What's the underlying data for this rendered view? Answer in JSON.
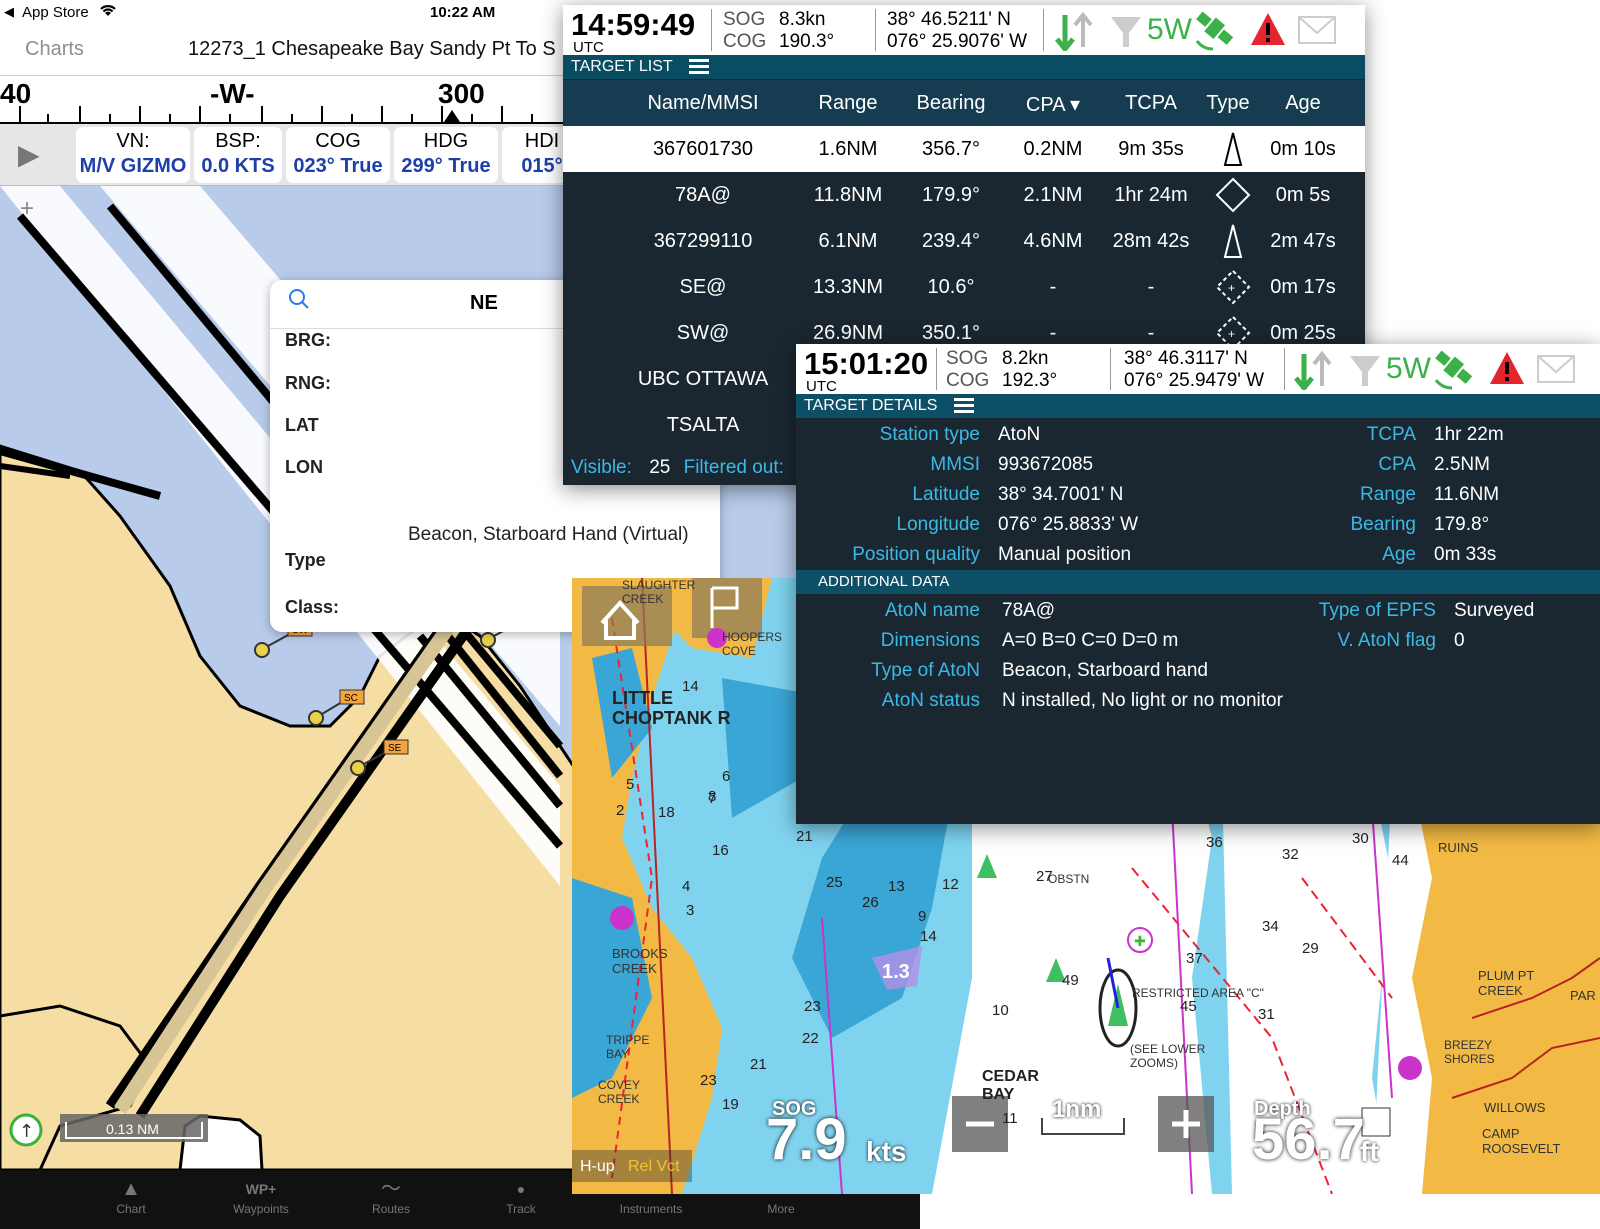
{
  "ipad": {
    "status": {
      "carrier": "App Store",
      "time": "10:22 AM"
    },
    "nav": {
      "back": "Charts",
      "title": "12273_1 Chesapeake Bay Sandy Pt To S"
    },
    "compass": {
      "ticks": [
        "40",
        "-W-",
        "300"
      ]
    },
    "instruments": [
      {
        "key": "VN:",
        "value": "M/V GIZMO"
      },
      {
        "key": "BSP:",
        "value": "0.0 KTS"
      },
      {
        "key": "COG",
        "value": "023° True"
      },
      {
        "key": "HDG",
        "value": "299° True"
      },
      {
        "key": "HDI",
        "value": "015°"
      }
    ],
    "popup": {
      "title": "NE",
      "labels": [
        "BRG:",
        "RNG:",
        "LAT",
        "LON",
        "Type",
        "Class:"
      ],
      "type_value": "Beacon, Starboard Hand (Virtual)"
    },
    "markers": [
      "SW",
      "SC",
      "SE",
      "NE"
    ],
    "scale": "0.13 NM",
    "tabs": [
      "Chart",
      "Waypoints",
      "Routes",
      "Track",
      "Instruments",
      "More"
    ],
    "tab_icons": [
      "▲",
      "WP+",
      "〜",
      "●",
      "",
      ""
    ]
  },
  "target_list": {
    "time": "14:59:49",
    "utc": "UTC",
    "sog_label": "SOG",
    "sog": "8.3kn",
    "cog_label": "COG",
    "cog": "190.3°",
    "lat": "38° 46.5211' N",
    "lon": "076° 25.9076' W",
    "gps_label": "5W",
    "bar_title": "TARGET LIST",
    "headers": [
      "Name/MMSI",
      "Range",
      "Bearing",
      "CPA ▾",
      "TCPA",
      "Type",
      "Age"
    ],
    "rows": [
      {
        "name": "367601730",
        "range": "1.6NM",
        "bearing": "356.7°",
        "cpa": "0.2NM",
        "tcpa": "9m 35s",
        "type": "vessel",
        "age": "0m 10s",
        "selected": true
      },
      {
        "name": "78A@",
        "range": "11.8NM",
        "bearing": "179.9°",
        "cpa": "2.1NM",
        "tcpa": "1hr 24m",
        "type": "diamond",
        "age": "0m 5s"
      },
      {
        "name": "367299110",
        "range": "6.1NM",
        "bearing": "239.4°",
        "cpa": "4.6NM",
        "tcpa": "28m 42s",
        "type": "vessel",
        "age": "2m 47s"
      },
      {
        "name": "SE@",
        "range": "13.3NM",
        "bearing": "10.6°",
        "cpa": "-",
        "tcpa": "-",
        "type": "virtual",
        "age": "0m 17s"
      },
      {
        "name": "SW@",
        "range": "26.9NM",
        "bearing": "350.1°",
        "cpa": "-",
        "tcpa": "-",
        "type": "virtual",
        "age": "0m 25s"
      },
      {
        "name": "UBC OTTAWA",
        "range": "",
        "bearing": "",
        "cpa": "",
        "tcpa": "",
        "type": "",
        "age": ""
      },
      {
        "name": "TSALTA",
        "range": "",
        "bearing": "",
        "cpa": "",
        "tcpa": "",
        "type": "",
        "age": ""
      }
    ],
    "footer": {
      "visible_label": "Visible:",
      "visible": "25",
      "filtered_label": "Filtered out:"
    }
  },
  "target_details": {
    "time": "15:01:20",
    "utc": "UTC",
    "sog_label": "SOG",
    "sog": "8.2kn",
    "cog_label": "COG",
    "cog": "192.3°",
    "lat": "38° 46.3117' N",
    "lon": "076° 25.9479' W",
    "gps_label": "5W",
    "bar_title": "TARGET DETAILS",
    "left": [
      {
        "label": "Station type",
        "value": "AtoN"
      },
      {
        "label": "MMSI",
        "value": "993672085"
      },
      {
        "label": "Latitude",
        "value": "38° 34.7001' N"
      },
      {
        "label": "Longitude",
        "value": "076° 25.8833' W"
      },
      {
        "label": "Position quality",
        "value": "Manual position"
      }
    ],
    "right": [
      {
        "label": "TCPA",
        "value": "1hr 22m"
      },
      {
        "label": "CPA",
        "value": "2.5NM"
      },
      {
        "label": "Range",
        "value": "11.6NM"
      },
      {
        "label": "Bearing",
        "value": "179.8°"
      },
      {
        "label": "Age",
        "value": "0m 33s"
      }
    ],
    "additional_title": "ADDITIONAL DATA",
    "additional_left": [
      {
        "label": "AtoN name",
        "value": "78A@"
      },
      {
        "label": "Dimensions",
        "value": "A=0 B=0 C=0 D=0 m"
      },
      {
        "label": "Type of AtoN",
        "value": "Beacon, Starboard hand"
      },
      {
        "label": "AtoN status",
        "value": "N installed, No light or no monitor"
      }
    ],
    "additional_right": [
      {
        "label": "Type of EPFS",
        "value": "Surveyed"
      },
      {
        "label": "V. AtoN flag",
        "value": "0"
      }
    ]
  },
  "navmap": {
    "sog_label": "SOG",
    "sog": "7.9",
    "sog_unit": "kts",
    "depth_label": "Depth",
    "depth": "56.7",
    "depth_unit": "ft",
    "scale": "1nm",
    "orientation": "H-up",
    "vector": "Rel Vct",
    "labels": [
      "LITTLE CHOPTANK R",
      "BROOKS CREEK",
      "TRIPPE BAY",
      "COVEY CREEK",
      "RESTRICTED AREA \"C\"",
      "(SEE LOWER ZOOMS)",
      "PLUM PT CREEK",
      "BREEZY SHORES",
      "WILLOWS",
      "CAMP ROOSEVELT",
      "RUINS",
      "OBSTN",
      "SLAUGHTER CREEK",
      "CEDAR BAY",
      "PAR",
      "HOOPERS COVE"
    ],
    "badge": "1.3",
    "depths": [
      "14",
      "18",
      "16",
      "21",
      "25",
      "26",
      "23",
      "22",
      "21",
      "23",
      "19",
      "13",
      "44",
      "36",
      "32",
      "38",
      "29",
      "30",
      "34",
      "27",
      "49",
      "45",
      "37",
      "31",
      "12",
      "14",
      "9",
      "10",
      "11",
      "8",
      "3",
      "5",
      "2",
      "4",
      "6",
      "7"
    ],
    "colors": {
      "deep": "#ffffff",
      "shallow": "#7fd3ef",
      "shoal": "#3aa6d6",
      "land": "#f2b944"
    }
  }
}
